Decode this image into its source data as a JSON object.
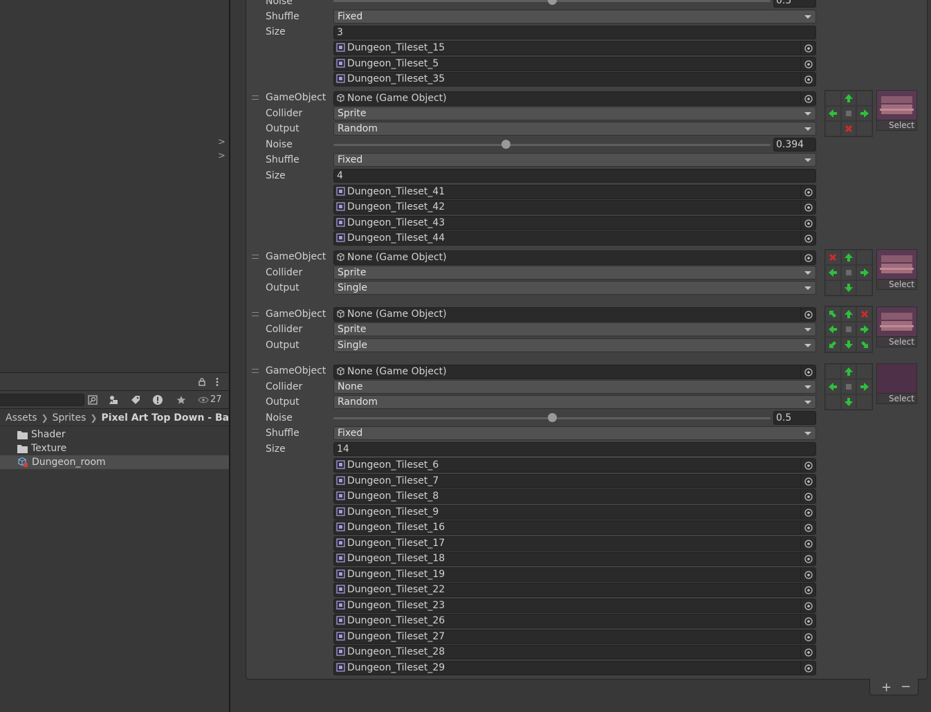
{
  "left_pane": {
    "chevrons": [
      ">",
      ">"
    ]
  },
  "project": {
    "toolbar": {
      "visible_count": "27"
    },
    "breadcrumb": [
      "Assets",
      "Sprites",
      "Pixel Art Top Down - Basic"
    ],
    "items": [
      {
        "label": "Shader",
        "icon": "folder-icon"
      },
      {
        "label": "Texture",
        "icon": "folder-icon"
      },
      {
        "label": "Dungeon_room",
        "icon": "rule-tile-icon",
        "selected": true
      }
    ]
  },
  "inspector": {
    "labels": {
      "gameobject": "GameObject",
      "collider": "Collider",
      "output": "Output",
      "noise": "Noise",
      "shuffle": "Shuffle",
      "size": "Size",
      "select": "Select",
      "none_go": "None (Game Object)"
    },
    "rule0": {
      "noise": "0.5",
      "shuffle": "Fixed",
      "size": "3",
      "sprites": [
        "Dungeon_Tileset_15",
        "Dungeon_Tileset_5",
        "Dungeon_Tileset_35"
      ]
    },
    "rule1": {
      "gameobject": "None (Game Object)",
      "collider": "Sprite",
      "output": "Random",
      "noise": "0.394",
      "noise_value": 0.394,
      "shuffle": "Fixed",
      "size": "4",
      "sprites": [
        "Dungeon_Tileset_41",
        "Dungeon_Tileset_42",
        "Dungeon_Tileset_43",
        "Dungeon_Tileset_44"
      ]
    },
    "rule2": {
      "gameobject": "None (Game Object)",
      "collider": "Sprite",
      "output": "Single"
    },
    "rule3": {
      "gameobject": "None (Game Object)",
      "collider": "Sprite",
      "output": "Single"
    },
    "rule4": {
      "gameobject": "None (Game Object)",
      "collider": "None",
      "output": "Random",
      "noise": "0.5",
      "noise_value": 0.5,
      "shuffle": "Fixed",
      "size": "14",
      "sprites": [
        "Dungeon_Tileset_6",
        "Dungeon_Tileset_7",
        "Dungeon_Tileset_8",
        "Dungeon_Tileset_9",
        "Dungeon_Tileset_16",
        "Dungeon_Tileset_17",
        "Dungeon_Tileset_18",
        "Dungeon_Tileset_19",
        "Dungeon_Tileset_22",
        "Dungeon_Tileset_23",
        "Dungeon_Tileset_26",
        "Dungeon_Tileset_27",
        "Dungeon_Tileset_28",
        "Dungeon_Tileset_29"
      ]
    },
    "footer": {
      "add": "+",
      "remove": "−"
    },
    "colors": {
      "arrow_green": "#2fbf3c",
      "cross_red": "#d02a2a",
      "preview_purple": "#5a3a52"
    }
  }
}
